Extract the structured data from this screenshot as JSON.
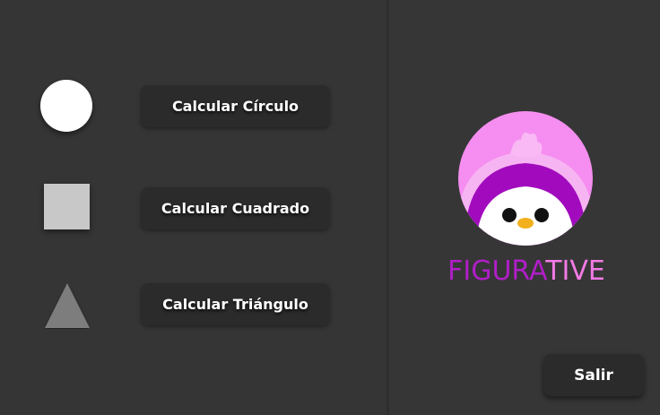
{
  "buttons": {
    "circle_label": "Calcular Círculo",
    "square_label": "Calcular Cuadrado",
    "triangle_label": "Calcular Triángulo",
    "exit_label": "Salir"
  },
  "logo": {
    "text_part_a": "FIGURA",
    "text_part_b": "TIVE",
    "avatar_icon": "penguin-icon"
  },
  "colors": {
    "background": "#353535",
    "button_bg": "#2b2b2b",
    "logo_purple": "#b01ec8",
    "logo_pink": "#f37ae6"
  },
  "icons": {
    "circle": "circle-shape-icon",
    "square": "square-shape-icon",
    "triangle": "triangle-shape-icon"
  }
}
